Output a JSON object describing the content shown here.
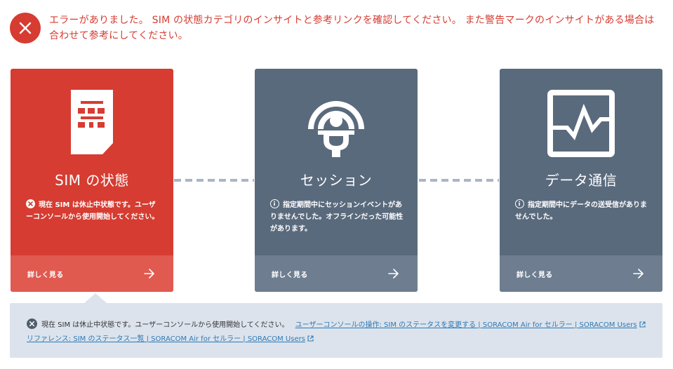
{
  "error_banner": {
    "icon": "close-icon",
    "color": "#d63c31",
    "message": "エラーがありました。 SIM の状態カテゴリのインサイトと参考リンクを確認してください。 また警告マークのインサイトがある場合は合わせて参考にしてください。"
  },
  "cards": [
    {
      "title": "SIM の状態",
      "icon": "sim-card-icon",
      "status": "error",
      "message": "現在 SIM は休止中状態です。ユーザーコンソールから使用開始してください。",
      "footer_label": "詳しく見る"
    },
    {
      "title": "セッション",
      "icon": "signal-antenna-icon",
      "status": "info",
      "message": "指定期間中にセッションイベントがありませんでした。オフラインだった可能性があります。",
      "footer_label": "詳しく見る"
    },
    {
      "title": "データ通信",
      "icon": "data-chart-icon",
      "status": "info",
      "message": "指定期間中にデータの送受信がありませんでした。",
      "footer_label": "詳しく見る"
    }
  ],
  "detail": {
    "message": "現在 SIM は休止中状態です。ユーザーコンソールから使用開始してください。",
    "links": [
      "ユーザーコンソールの操作: SIM のステータスを変更する | SORACOM Air for セルラー | SORACOM Users",
      "リファレンス: SIM のステータス一覧 | SORACOM Air for セルラー | SORACOM Users"
    ]
  },
  "colors": {
    "error": "#d63c31",
    "card_gray": "#5a6a7d",
    "panel": "#dce3ec",
    "link": "#2e79b5"
  }
}
